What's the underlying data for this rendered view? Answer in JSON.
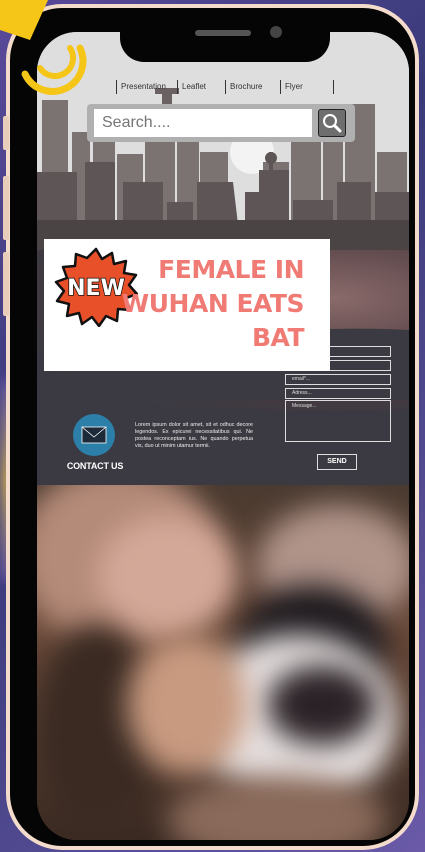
{
  "nav": {
    "items": [
      {
        "label": "Presentation"
      },
      {
        "label": "Leaflet"
      },
      {
        "label": "Brochure"
      },
      {
        "label": "Flyer"
      }
    ]
  },
  "search": {
    "placeholder": "Search...."
  },
  "headline": {
    "badge": "NEW",
    "line1": "FEMALE IN",
    "line2": "WUHAN EATS",
    "line3": "BAT"
  },
  "contact": {
    "label": "CONTACT US",
    "body": "Lorem ipsum dolor sit amet, sit et odhuc decore legendos. Ex epicurei necessitatibus qui. Ne postea reconceptam ius. Ne quando perpetua vis, duo ut minim utamur termii.",
    "fields": [
      {
        "placeholder": "email*..."
      },
      {
        "placeholder": "Adress..."
      },
      {
        "placeholder": "Message..."
      }
    ],
    "send_label": "SEND"
  },
  "colors": {
    "headline": "#f07a74",
    "badge_fill": "#e8502a",
    "contact_icon": "#2c7fa8",
    "overlay_badge": "#f5c518"
  }
}
